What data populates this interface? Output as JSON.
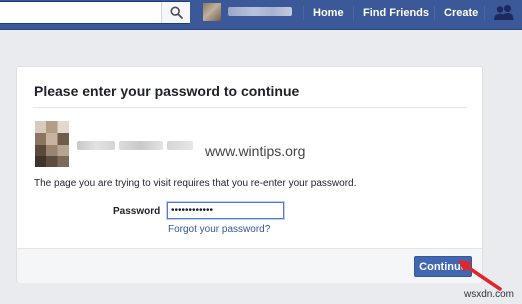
{
  "topbar": {
    "nav": {
      "home": "Home",
      "find_friends": "Find Friends",
      "create": "Create"
    },
    "icons": {
      "search": "search-icon",
      "friends": "friends-icon"
    }
  },
  "dialog": {
    "title": "Please enter your password to continue",
    "info_text": "The page you are trying to visit requires that you re-enter your password.",
    "password_label": "Password",
    "password_value": "••••••••••••",
    "forgot_link": "Forgot your password?",
    "continue_label": "Continue"
  },
  "watermark": "www.wintips.org",
  "credit": "wsxdn.com",
  "colors": {
    "brand_blue": "#3b5998",
    "button_blue": "#4267b2",
    "link_blue": "#365899",
    "annotation_red": "#e0262b"
  }
}
